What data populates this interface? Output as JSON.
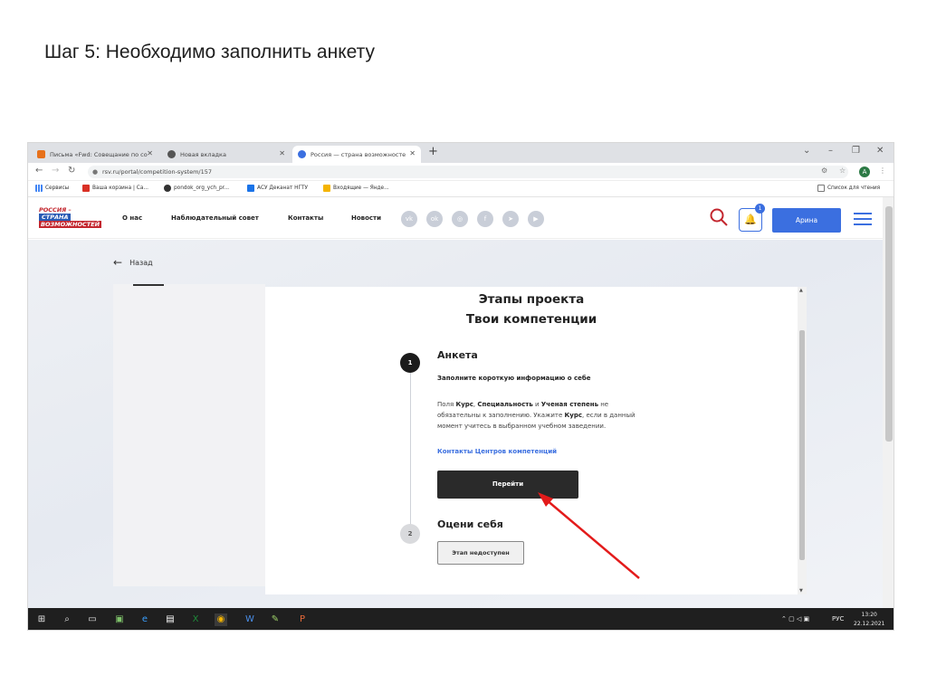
{
  "slide": {
    "title": "Шаг 5: Необходимо заполнить анкету"
  },
  "browser": {
    "tabs": [
      {
        "title": "Письма «Fwd: Совещание по со",
        "icon": "mail-icon",
        "color": "#e7711b"
      },
      {
        "title": "Новая вкладка",
        "icon": "globe-icon",
        "color": "#555555"
      },
      {
        "title": "Россия — страна возможносте",
        "icon": "site-icon",
        "color": "#3b6fe0"
      }
    ],
    "url": "rsv.ru/portal/competition-system/157",
    "avatar_letter": "A",
    "bookmarks": [
      {
        "label": "Сервисы",
        "icon": "apps-grid-icon",
        "color": "#4285f4"
      },
      {
        "label": "Ваша корзина | Са...",
        "icon": "cart-bookmark-icon",
        "color": "#d93025"
      },
      {
        "label": "pondok_org_ych_pr...",
        "icon": "github-icon",
        "color": "#333333"
      },
      {
        "label": "АСУ Деканат НГТУ",
        "icon": "d-bookmark-icon",
        "color": "#1a73e8"
      },
      {
        "label": "Входящие — Янде...",
        "icon": "yandex-mail-icon",
        "color": "#f4b400"
      }
    ],
    "reading_list": "Список для чтения"
  },
  "site": {
    "logo": {
      "line1": "РОССИЯ –",
      "line2": "СТРАНА",
      "line3": "ВОЗМОЖНОСТЕЙ"
    },
    "nav": [
      "О нас",
      "Наблюдательный совет",
      "Контакты",
      "Новости"
    ],
    "social": [
      "vk-icon",
      "ok-icon",
      "instagram-icon",
      "facebook-icon",
      "telegram-icon",
      "youtube-icon"
    ],
    "notifications": "1",
    "user": "Арина",
    "accent": "#3b6fe0"
  },
  "page": {
    "back": "Назад",
    "title1": "Этапы проекта",
    "title2": "Твои компетенции",
    "steps": [
      {
        "num": "1",
        "title": "Анкета",
        "subtitle": "Заполните короткую информацию о себе",
        "desc_parts": [
          "Поля ",
          "Курс",
          ", ",
          "Специальность",
          " и ",
          "Ученая степень",
          " не обязательны к заполнению. Укажите ",
          "Курс",
          ", если в данный момент учитесь в выбранном учебном заведении."
        ],
        "link": "Контакты Центров компетенций",
        "button": "Перейти"
      },
      {
        "num": "2",
        "title": "Оцени себя",
        "button": "Этап недоступен"
      }
    ]
  },
  "taskbar": {
    "lang": "РУС",
    "time": "13:20",
    "date": "22.12.2021"
  }
}
